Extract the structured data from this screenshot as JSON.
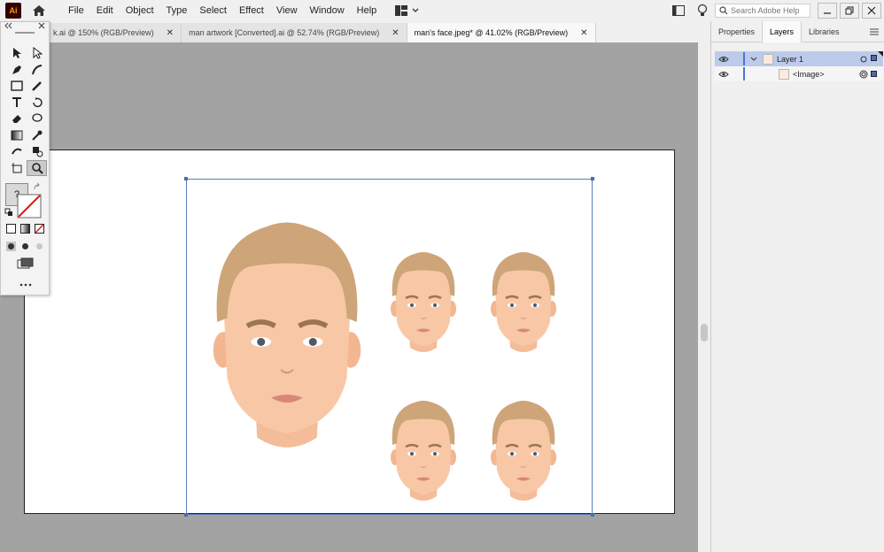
{
  "app": {
    "logo": "Ai"
  },
  "menu": [
    "File",
    "Edit",
    "Object",
    "Type",
    "Select",
    "Effect",
    "View",
    "Window",
    "Help"
  ],
  "search": {
    "placeholder": "Search Adobe Help"
  },
  "tabs": [
    {
      "label": "k.ai @ 150% (RGB/Preview)",
      "active": false
    },
    {
      "label": "man artwork  [Converted].ai @ 52.74% (RGB/Preview)",
      "active": false
    },
    {
      "label": "man's face.jpeg* @ 41.02% (RGB/Preview)",
      "active": true
    }
  ],
  "tab_close": "✕",
  "panel_tabs": [
    "Properties",
    "Layers",
    "Libraries"
  ],
  "layers": [
    {
      "name": "Layer 1",
      "selected": true
    },
    {
      "name": "<Image>",
      "selected": false
    }
  ],
  "toolbox": {
    "unknown_fill": "?"
  },
  "colors": {
    "accent": "#4a6cb0",
    "skin": "#f8c8a6",
    "hair": "#cda578"
  }
}
